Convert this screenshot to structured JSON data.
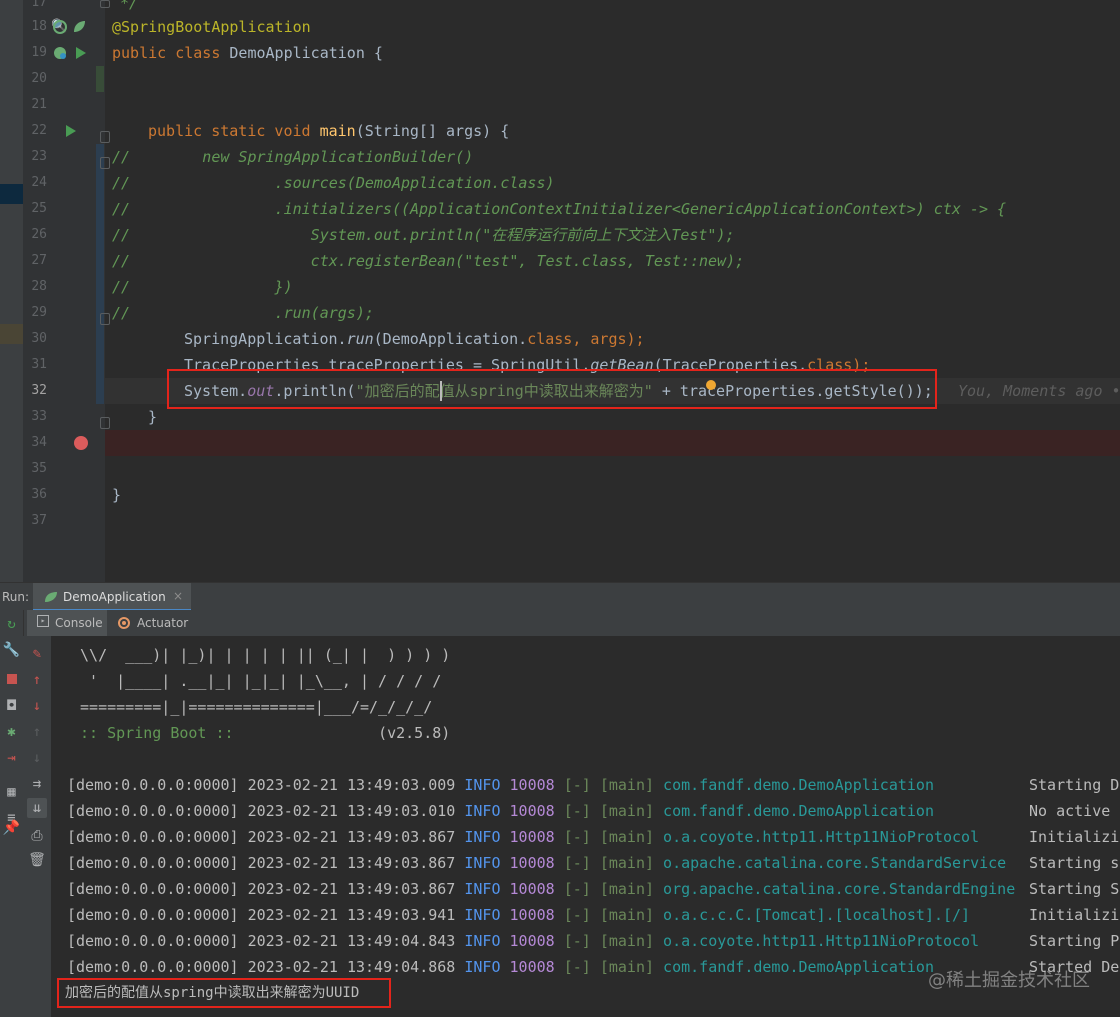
{
  "editor": {
    "line_numbers": [
      "17",
      "18",
      "19",
      "20",
      "21",
      "22",
      "23",
      "24",
      "25",
      "26",
      "27",
      "28",
      "29",
      "30",
      "31",
      "32",
      "33",
      "34",
      "35",
      "36",
      "37"
    ],
    "lines": {
      "l17": "*/",
      "l18_annotation": "@SpringBootApplication",
      "l19_kw1": "public",
      "l19_kw2": "class",
      "l19_rest": "DemoApplication {",
      "l22_kw": "public static void",
      "l22_fn": "main",
      "l22_rest": "(String[] args) {",
      "l23": "//        new SpringApplicationBuilder()",
      "l24": "//                .sources(DemoApplication.class)",
      "l25": "//                .initializers((ApplicationContextInitializer<GenericApplicationContext>) ctx -> {",
      "l26": "//                    System.out.println(\"在程序运行前向上下文注入Test\");",
      "l27": "//                    ctx.registerBean(\"test\", Test.class, Test::new);",
      "l28": "//                })",
      "l29": "//                .run(args);",
      "l30_a": "SpringApplication.",
      "l30_b": "run",
      "l30_c": "(DemoApplication.",
      "l30_d": "class",
      "l30_e": ", args);",
      "l31_a": "TraceProperties traceProperties = SpringUtil.",
      "l31_b": "getBean",
      "l31_c": "(TraceProperties.",
      "l31_d": "class",
      "l31_e": ");",
      "l32_a": "System.",
      "l32_b": "out",
      "l32_c": ".println(",
      "l32_str": "\"加密后的配值从spring中读取出来解密为\"",
      "l32_d": " + traceProperties.getStyle());",
      "l32_inlay": "You, Moments ago •",
      "l33": "}",
      "l36": "}"
    }
  },
  "run": {
    "label": "Run:",
    "tab_title": "DemoApplication",
    "tab_close": "×",
    "subtabs": [
      "Console",
      "Actuator"
    ]
  },
  "console": {
    "banner": [
      " \\\\/  ___)| |_)| | | | | || (_| |  ) ) ) )",
      "  '  |____| .__|_| |_|_| |_\\__, | / / / /",
      " =========|_|==============|___/=/_/_/_/"
    ],
    "spring_boot_label": " :: Spring Boot ::",
    "spring_boot_version": "(v2.5.8)",
    "logs": [
      {
        "prefix": "[demo:0.0.0.0:0000] 2023-02-21 13:49:03.009",
        "level": "INFO",
        "pid": "10008",
        "dash": "[-]",
        "thread": "[main]",
        "logger": "com.fandf.demo.DemoApplication",
        "msg": "Starting D"
      },
      {
        "prefix": "[demo:0.0.0.0:0000] 2023-02-21 13:49:03.010",
        "level": "INFO",
        "pid": "10008",
        "dash": "[-]",
        "thread": "[main]",
        "logger": "com.fandf.demo.DemoApplication",
        "msg": "No active"
      },
      {
        "prefix": "[demo:0.0.0.0:0000] 2023-02-21 13:49:03.867",
        "level": "INFO",
        "pid": "10008",
        "dash": "[-]",
        "thread": "[main]",
        "logger": "o.a.coyote.http11.Http11NioProtocol",
        "msg": "Initializi"
      },
      {
        "prefix": "[demo:0.0.0.0:0000] 2023-02-21 13:49:03.867",
        "level": "INFO",
        "pid": "10008",
        "dash": "[-]",
        "thread": "[main]",
        "logger": "o.apache.catalina.core.StandardService",
        "msg": "Starting s"
      },
      {
        "prefix": "[demo:0.0.0.0:0000] 2023-02-21 13:49:03.867",
        "level": "INFO",
        "pid": "10008",
        "dash": "[-]",
        "thread": "[main]",
        "logger": "org.apache.catalina.core.StandardEngine",
        "msg": "Starting S"
      },
      {
        "prefix": "[demo:0.0.0.0:0000] 2023-02-21 13:49:03.941",
        "level": "INFO",
        "pid": "10008",
        "dash": "[-]",
        "thread": "[main]",
        "logger": "o.a.c.c.C.[Tomcat].[localhost].[/]",
        "msg": "Initializi"
      },
      {
        "prefix": "[demo:0.0.0.0:0000] 2023-02-21 13:49:04.843",
        "level": "INFO",
        "pid": "10008",
        "dash": "[-]",
        "thread": "[main]",
        "logger": "o.a.coyote.http11.Http11NioProtocol",
        "msg": "Starting P"
      },
      {
        "prefix": "[demo:0.0.0.0:0000] 2023-02-21 13:49:04.868",
        "level": "INFO",
        "pid": "10008",
        "dash": "[-]",
        "thread": "[main]",
        "logger": "com.fandf.demo.DemoApplication",
        "msg": "Started De"
      }
    ],
    "output_line": "加密后的配值从spring中读取出来解密为UUID"
  },
  "watermark": "@稀土掘金技术社区",
  "colors": {
    "highlight_box": "#e3241b",
    "background": "#2b2b2b",
    "info": "#5394ec"
  }
}
